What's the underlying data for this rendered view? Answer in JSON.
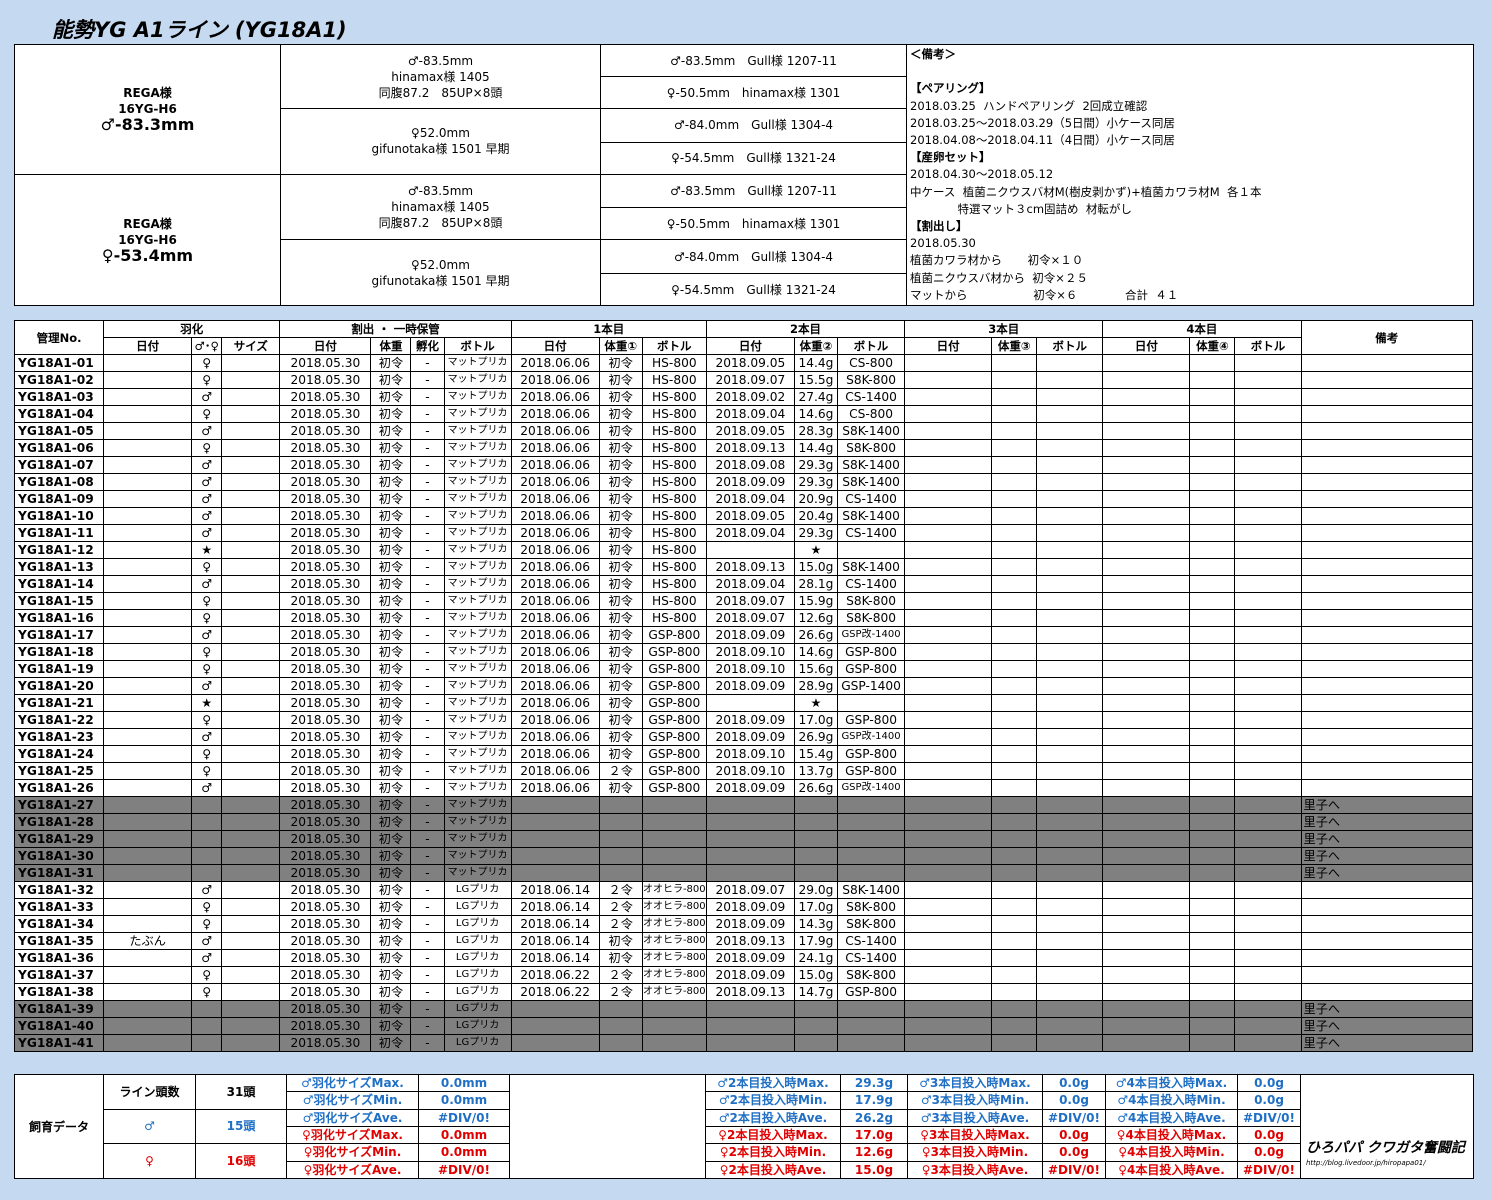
{
  "title": "能勢YG  A1ライン (YG18A1)",
  "pedigree": {
    "parents": [
      {
        "owner": "REGA様",
        "line": "16YG-H6",
        "size": "♂-83.3mm",
        "top_parent": {
          "size": "♂-83.5mm",
          "owner": "hinamax様 1405",
          "note": "同腹87.2　85UP×8頭"
        },
        "bottom_parent": {
          "size": "♀52.0mm",
          "owner": "gifunotaka様 1501 早期"
        },
        "grand": [
          "♂-83.5mm　Gull様 1207-11",
          "♀-50.5mm　hinamax様 1301",
          "♂-84.0mm　Gull様 1304-4",
          "♀-54.5mm　Gull様 1321-24"
        ]
      },
      {
        "owner": "REGA様",
        "line": "16YG-H6",
        "size": "♀-53.4mm",
        "top_parent": {
          "size": "♂-83.5mm",
          "owner": "hinamax様 1405",
          "note": "同腹87.2　85UP×8頭"
        },
        "bottom_parent": {
          "size": "♀52.0mm",
          "owner": "gifunotaka様 1501 早期"
        },
        "grand": [
          "♂-83.5mm　Gull様 1207-11",
          "♀-50.5mm　hinamax様 1301",
          "♂-84.0mm　Gull様 1304-4",
          "♀-54.5mm　Gull様 1321-24"
        ]
      }
    ],
    "notes": [
      {
        "t": "＜備考＞",
        "b": true
      },
      {
        "t": "",
        "b": false
      },
      {
        "t": "【ペアリング】",
        "b": true
      },
      {
        "t": "2018.03.25  ハンドペアリング  2回成立確認",
        "b": false
      },
      {
        "t": "2018.03.25～2018.03.29（5日間）小ケース同居",
        "b": false
      },
      {
        "t": "2018.04.08～2018.04.11（4日間）小ケース同居",
        "b": false
      },
      {
        "t": "【産卵セット】",
        "b": true
      },
      {
        "t": "2018.04.30～2018.05.12",
        "b": false
      },
      {
        "t": "中ケース  植菌ニクウスバ材M(樹皮剥かず)+植菌カワラ材M  各１本",
        "b": false
      },
      {
        "t": "             特選マット３cm固詰め  材転がし",
        "b": false
      },
      {
        "t": "【割出し】",
        "b": true
      },
      {
        "t": "2018.05.30",
        "b": false
      },
      {
        "t": "植菌カワラ材から       初令×１０",
        "b": false
      },
      {
        "t": "植菌ニクウスバ材から  初令×２５",
        "b": false
      },
      {
        "t": "マットから                  初令×６             合計  ４１",
        "b": false
      }
    ]
  },
  "headers": {
    "kanri": "管理No.",
    "uka": "羽化",
    "wari": "割出 ・ 一時保管",
    "b1": "1本目",
    "b2": "2本目",
    "b3": "3本目",
    "b4": "4本目",
    "biko": "備考",
    "date": "日付",
    "sex": "♂･♀",
    "size": "サイズ",
    "weight": "体重",
    "fuka": "孵化",
    "bottle": "ボトル",
    "w1": "体重①",
    "w2": "体重②",
    "w3": "体重③",
    "w4": "体重④"
  },
  "rows": [
    {
      "id": "YG18A1-01",
      "ud": "",
      "sex": "♀",
      "sz": "",
      "wd": "2018.05.30",
      "ww": "初令",
      "wf": "-",
      "wb": "マットプリカ",
      "d1": "2018.06.06",
      "w1": "初令",
      "b1": "HS-800",
      "d2": "2018.09.05",
      "w2": "14.4g",
      "b2": "CS-800",
      "note": "",
      "gray": false
    },
    {
      "id": "YG18A1-02",
      "ud": "",
      "sex": "♀",
      "sz": "",
      "wd": "2018.05.30",
      "ww": "初令",
      "wf": "-",
      "wb": "マットプリカ",
      "d1": "2018.06.06",
      "w1": "初令",
      "b1": "HS-800",
      "d2": "2018.09.07",
      "w2": "15.5g",
      "b2": "S8K-800",
      "note": "",
      "gray": false
    },
    {
      "id": "YG18A1-03",
      "ud": "",
      "sex": "♂",
      "sz": "",
      "wd": "2018.05.30",
      "ww": "初令",
      "wf": "-",
      "wb": "マットプリカ",
      "d1": "2018.06.06",
      "w1": "初令",
      "b1": "HS-800",
      "d2": "2018.09.02",
      "w2": "27.4g",
      "b2": "CS-1400",
      "note": "",
      "gray": false
    },
    {
      "id": "YG18A1-04",
      "ud": "",
      "sex": "♀",
      "sz": "",
      "wd": "2018.05.30",
      "ww": "初令",
      "wf": "-",
      "wb": "マットプリカ",
      "d1": "2018.06.06",
      "w1": "初令",
      "b1": "HS-800",
      "d2": "2018.09.04",
      "w2": "14.6g",
      "b2": "CS-800",
      "note": "",
      "gray": false
    },
    {
      "id": "YG18A1-05",
      "ud": "",
      "sex": "♂",
      "sz": "",
      "wd": "2018.05.30",
      "ww": "初令",
      "wf": "-",
      "wb": "マットプリカ",
      "d1": "2018.06.06",
      "w1": "初令",
      "b1": "HS-800",
      "d2": "2018.09.05",
      "w2": "28.3g",
      "b2": "S8K-1400",
      "note": "",
      "gray": false
    },
    {
      "id": "YG18A1-06",
      "ud": "",
      "sex": "♀",
      "sz": "",
      "wd": "2018.05.30",
      "ww": "初令",
      "wf": "-",
      "wb": "マットプリカ",
      "d1": "2018.06.06",
      "w1": "初令",
      "b1": "HS-800",
      "d2": "2018.09.13",
      "w2": "14.4g",
      "b2": "S8K-800",
      "note": "",
      "gray": false
    },
    {
      "id": "YG18A1-07",
      "ud": "",
      "sex": "♂",
      "sz": "",
      "wd": "2018.05.30",
      "ww": "初令",
      "wf": "-",
      "wb": "マットプリカ",
      "d1": "2018.06.06",
      "w1": "初令",
      "b1": "HS-800",
      "d2": "2018.09.08",
      "w2": "29.3g",
      "b2": "S8K-1400",
      "note": "",
      "gray": false
    },
    {
      "id": "YG18A1-08",
      "ud": "",
      "sex": "♂",
      "sz": "",
      "wd": "2018.05.30",
      "ww": "初令",
      "wf": "-",
      "wb": "マットプリカ",
      "d1": "2018.06.06",
      "w1": "初令",
      "b1": "HS-800",
      "d2": "2018.09.09",
      "w2": "29.3g",
      "b2": "S8K-1400",
      "note": "",
      "gray": false
    },
    {
      "id": "YG18A1-09",
      "ud": "",
      "sex": "♂",
      "sz": "",
      "wd": "2018.05.30",
      "ww": "初令",
      "wf": "-",
      "wb": "マットプリカ",
      "d1": "2018.06.06",
      "w1": "初令",
      "b1": "HS-800",
      "d2": "2018.09.04",
      "w2": "20.9g",
      "b2": "CS-1400",
      "note": "",
      "gray": false
    },
    {
      "id": "YG18A1-10",
      "ud": "",
      "sex": "♂",
      "sz": "",
      "wd": "2018.05.30",
      "ww": "初令",
      "wf": "-",
      "wb": "マットプリカ",
      "d1": "2018.06.06",
      "w1": "初令",
      "b1": "HS-800",
      "d2": "2018.09.05",
      "w2": "20.4g",
      "b2": "S8K-1400",
      "note": "",
      "gray": false
    },
    {
      "id": "YG18A1-11",
      "ud": "",
      "sex": "♂",
      "sz": "",
      "wd": "2018.05.30",
      "ww": "初令",
      "wf": "-",
      "wb": "マットプリカ",
      "d1": "2018.06.06",
      "w1": "初令",
      "b1": "HS-800",
      "d2": "2018.09.04",
      "w2": "29.3g",
      "b2": "CS-1400",
      "note": "",
      "gray": false
    },
    {
      "id": "YG18A1-12",
      "ud": "",
      "sex": "★",
      "sz": "",
      "wd": "2018.05.30",
      "ww": "初令",
      "wf": "-",
      "wb": "マットプリカ",
      "d1": "2018.06.06",
      "w1": "初令",
      "b1": "HS-800",
      "d2": "",
      "w2": "★",
      "b2": "",
      "note": "",
      "gray": false
    },
    {
      "id": "YG18A1-13",
      "ud": "",
      "sex": "♀",
      "sz": "",
      "wd": "2018.05.30",
      "ww": "初令",
      "wf": "-",
      "wb": "マットプリカ",
      "d1": "2018.06.06",
      "w1": "初令",
      "b1": "HS-800",
      "d2": "2018.09.13",
      "w2": "15.0g",
      "b2": "S8K-1400",
      "note": "",
      "gray": false
    },
    {
      "id": "YG18A1-14",
      "ud": "",
      "sex": "♂",
      "sz": "",
      "wd": "2018.05.30",
      "ww": "初令",
      "wf": "-",
      "wb": "マットプリカ",
      "d1": "2018.06.06",
      "w1": "初令",
      "b1": "HS-800",
      "d2": "2018.09.04",
      "w2": "28.1g",
      "b2": "CS-1400",
      "note": "",
      "gray": false
    },
    {
      "id": "YG18A1-15",
      "ud": "",
      "sex": "♀",
      "sz": "",
      "wd": "2018.05.30",
      "ww": "初令",
      "wf": "-",
      "wb": "マットプリカ",
      "d1": "2018.06.06",
      "w1": "初令",
      "b1": "HS-800",
      "d2": "2018.09.07",
      "w2": "15.9g",
      "b2": "S8K-800",
      "note": "",
      "gray": false
    },
    {
      "id": "YG18A1-16",
      "ud": "",
      "sex": "♀",
      "sz": "",
      "wd": "2018.05.30",
      "ww": "初令",
      "wf": "-",
      "wb": "マットプリカ",
      "d1": "2018.06.06",
      "w1": "初令",
      "b1": "HS-800",
      "d2": "2018.09.07",
      "w2": "12.6g",
      "b2": "S8K-800",
      "note": "",
      "gray": false
    },
    {
      "id": "YG18A1-17",
      "ud": "",
      "sex": "♂",
      "sz": "",
      "wd": "2018.05.30",
      "ww": "初令",
      "wf": "-",
      "wb": "マットプリカ",
      "d1": "2018.06.06",
      "w1": "初令",
      "b1": "GSP-800",
      "d2": "2018.09.09",
      "w2": "26.6g",
      "b2": "GSP改-1400",
      "note": "",
      "gray": false
    },
    {
      "id": "YG18A1-18",
      "ud": "",
      "sex": "♀",
      "sz": "",
      "wd": "2018.05.30",
      "ww": "初令",
      "wf": "-",
      "wb": "マットプリカ",
      "d1": "2018.06.06",
      "w1": "初令",
      "b1": "GSP-800",
      "d2": "2018.09.10",
      "w2": "14.6g",
      "b2": "GSP-800",
      "note": "",
      "gray": false
    },
    {
      "id": "YG18A1-19",
      "ud": "",
      "sex": "♀",
      "sz": "",
      "wd": "2018.05.30",
      "ww": "初令",
      "wf": "-",
      "wb": "マットプリカ",
      "d1": "2018.06.06",
      "w1": "初令",
      "b1": "GSP-800",
      "d2": "2018.09.10",
      "w2": "15.6g",
      "b2": "GSP-800",
      "note": "",
      "gray": false
    },
    {
      "id": "YG18A1-20",
      "ud": "",
      "sex": "♂",
      "sz": "",
      "wd": "2018.05.30",
      "ww": "初令",
      "wf": "-",
      "wb": "マットプリカ",
      "d1": "2018.06.06",
      "w1": "初令",
      "b1": "GSP-800",
      "d2": "2018.09.09",
      "w2": "28.9g",
      "b2": "GSP-1400",
      "note": "",
      "gray": false
    },
    {
      "id": "YG18A1-21",
      "ud": "",
      "sex": "★",
      "sz": "",
      "wd": "2018.05.30",
      "ww": "初令",
      "wf": "-",
      "wb": "マットプリカ",
      "d1": "2018.06.06",
      "w1": "初令",
      "b1": "GSP-800",
      "d2": "",
      "w2": "★",
      "b2": "",
      "note": "",
      "gray": false
    },
    {
      "id": "YG18A1-22",
      "ud": "",
      "sex": "♀",
      "sz": "",
      "wd": "2018.05.30",
      "ww": "初令",
      "wf": "-",
      "wb": "マットプリカ",
      "d1": "2018.06.06",
      "w1": "初令",
      "b1": "GSP-800",
      "d2": "2018.09.09",
      "w2": "17.0g",
      "b2": "GSP-800",
      "note": "",
      "gray": false
    },
    {
      "id": "YG18A1-23",
      "ud": "",
      "sex": "♂",
      "sz": "",
      "wd": "2018.05.30",
      "ww": "初令",
      "wf": "-",
      "wb": "マットプリカ",
      "d1": "2018.06.06",
      "w1": "初令",
      "b1": "GSP-800",
      "d2": "2018.09.09",
      "w2": "26.9g",
      "b2": "GSP改-1400",
      "note": "",
      "gray": false
    },
    {
      "id": "YG18A1-24",
      "ud": "",
      "sex": "♀",
      "sz": "",
      "wd": "2018.05.30",
      "ww": "初令",
      "wf": "-",
      "wb": "マットプリカ",
      "d1": "2018.06.06",
      "w1": "初令",
      "b1": "GSP-800",
      "d2": "2018.09.10",
      "w2": "15.4g",
      "b2": "GSP-800",
      "note": "",
      "gray": false
    },
    {
      "id": "YG18A1-25",
      "ud": "",
      "sex": "♀",
      "sz": "",
      "wd": "2018.05.30",
      "ww": "初令",
      "wf": "-",
      "wb": "マットプリカ",
      "d1": "2018.06.06",
      "w1": "２令",
      "b1": "GSP-800",
      "d2": "2018.09.10",
      "w2": "13.7g",
      "b2": "GSP-800",
      "note": "",
      "gray": false
    },
    {
      "id": "YG18A1-26",
      "ud": "",
      "sex": "♂",
      "sz": "",
      "wd": "2018.05.30",
      "ww": "初令",
      "wf": "-",
      "wb": "マットプリカ",
      "d1": "2018.06.06",
      "w1": "初令",
      "b1": "GSP-800",
      "d2": "2018.09.09",
      "w2": "26.6g",
      "b2": "GSP改-1400",
      "note": "",
      "gray": false
    },
    {
      "id": "YG18A1-27",
      "ud": "",
      "sex": "",
      "sz": "",
      "wd": "2018.05.30",
      "ww": "初令",
      "wf": "-",
      "wb": "マットプリカ",
      "d1": "",
      "w1": "",
      "b1": "",
      "d2": "",
      "w2": "",
      "b2": "",
      "note": "里子へ",
      "gray": true
    },
    {
      "id": "YG18A1-28",
      "ud": "",
      "sex": "",
      "sz": "",
      "wd": "2018.05.30",
      "ww": "初令",
      "wf": "-",
      "wb": "マットプリカ",
      "d1": "",
      "w1": "",
      "b1": "",
      "d2": "",
      "w2": "",
      "b2": "",
      "note": "里子へ",
      "gray": true
    },
    {
      "id": "YG18A1-29",
      "ud": "",
      "sex": "",
      "sz": "",
      "wd": "2018.05.30",
      "ww": "初令",
      "wf": "-",
      "wb": "マットプリカ",
      "d1": "",
      "w1": "",
      "b1": "",
      "d2": "",
      "w2": "",
      "b2": "",
      "note": "里子へ",
      "gray": true
    },
    {
      "id": "YG18A1-30",
      "ud": "",
      "sex": "",
      "sz": "",
      "wd": "2018.05.30",
      "ww": "初令",
      "wf": "-",
      "wb": "マットプリカ",
      "d1": "",
      "w1": "",
      "b1": "",
      "d2": "",
      "w2": "",
      "b2": "",
      "note": "里子へ",
      "gray": true
    },
    {
      "id": "YG18A1-31",
      "ud": "",
      "sex": "",
      "sz": "",
      "wd": "2018.05.30",
      "ww": "初令",
      "wf": "-",
      "wb": "マットプリカ",
      "d1": "",
      "w1": "",
      "b1": "",
      "d2": "",
      "w2": "",
      "b2": "",
      "note": "里子へ",
      "gray": true
    },
    {
      "id": "YG18A1-32",
      "ud": "",
      "sex": "♂",
      "sz": "",
      "wd": "2018.05.30",
      "ww": "初令",
      "wf": "-",
      "wb": "LGプリカ",
      "d1": "2018.06.14",
      "w1": "２令",
      "b1": "オオヒラ-800",
      "d2": "2018.09.07",
      "w2": "29.0g",
      "b2": "S8K-1400",
      "note": "",
      "gray": false
    },
    {
      "id": "YG18A1-33",
      "ud": "",
      "sex": "♀",
      "sz": "",
      "wd": "2018.05.30",
      "ww": "初令",
      "wf": "-",
      "wb": "LGプリカ",
      "d1": "2018.06.14",
      "w1": "２令",
      "b1": "オオヒラ-800",
      "d2": "2018.09.09",
      "w2": "17.0g",
      "b2": "S8K-800",
      "note": "",
      "gray": false
    },
    {
      "id": "YG18A1-34",
      "ud": "",
      "sex": "♀",
      "sz": "",
      "wd": "2018.05.30",
      "ww": "初令",
      "wf": "-",
      "wb": "LGプリカ",
      "d1": "2018.06.14",
      "w1": "２令",
      "b1": "オオヒラ-800",
      "d2": "2018.09.09",
      "w2": "14.3g",
      "b2": "S8K-800",
      "note": "",
      "gray": false
    },
    {
      "id": "YG18A1-35",
      "ud": "たぶん",
      "sex": "♂",
      "sz": "",
      "wd": "2018.05.30",
      "ww": "初令",
      "wf": "-",
      "wb": "LGプリカ",
      "d1": "2018.06.14",
      "w1": "初令",
      "b1": "オオヒラ-800",
      "d2": "2018.09.13",
      "w2": "17.9g",
      "b2": "CS-1400",
      "note": "",
      "gray": false
    },
    {
      "id": "YG18A1-36",
      "ud": "",
      "sex": "♂",
      "sz": "",
      "wd": "2018.05.30",
      "ww": "初令",
      "wf": "-",
      "wb": "LGプリカ",
      "d1": "2018.06.14",
      "w1": "初令",
      "b1": "オオヒラ-800",
      "d2": "2018.09.09",
      "w2": "24.1g",
      "b2": "CS-1400",
      "note": "",
      "gray": false
    },
    {
      "id": "YG18A1-37",
      "ud": "",
      "sex": "♀",
      "sz": "",
      "wd": "2018.05.30",
      "ww": "初令",
      "wf": "-",
      "wb": "LGプリカ",
      "d1": "2018.06.22",
      "w1": "２令",
      "b1": "オオヒラ-800",
      "d2": "2018.09.09",
      "w2": "15.0g",
      "b2": "S8K-800",
      "note": "",
      "gray": false
    },
    {
      "id": "YG18A1-38",
      "ud": "",
      "sex": "♀",
      "sz": "",
      "wd": "2018.05.30",
      "ww": "初令",
      "wf": "-",
      "wb": "LGプリカ",
      "d1": "2018.06.22",
      "w1": "２令",
      "b1": "オオヒラ-800",
      "d2": "2018.09.13",
      "w2": "14.7g",
      "b2": "GSP-800",
      "note": "",
      "gray": false
    },
    {
      "id": "YG18A1-39",
      "ud": "",
      "sex": "",
      "sz": "",
      "wd": "2018.05.30",
      "ww": "初令",
      "wf": "-",
      "wb": "LGプリカ",
      "d1": "",
      "w1": "",
      "b1": "",
      "d2": "",
      "w2": "",
      "b2": "",
      "note": "里子へ",
      "gray": true
    },
    {
      "id": "YG18A1-40",
      "ud": "",
      "sex": "",
      "sz": "",
      "wd": "2018.05.30",
      "ww": "初令",
      "wf": "-",
      "wb": "LGプリカ",
      "d1": "",
      "w1": "",
      "b1": "",
      "d2": "",
      "w2": "",
      "b2": "",
      "note": "里子へ",
      "gray": true
    },
    {
      "id": "YG18A1-41",
      "ud": "",
      "sex": "",
      "sz": "",
      "wd": "2018.05.30",
      "ww": "初令",
      "wf": "-",
      "wb": "LGプリカ",
      "d1": "",
      "w1": "",
      "b1": "",
      "d2": "",
      "w2": "",
      "b2": "",
      "note": "里子へ",
      "gray": true
    }
  ],
  "summary": {
    "label": "飼育データ",
    "count_label": "ライン頭数",
    "count": "31頭",
    "male_sym": "♂",
    "male_count": "15頭",
    "female_sym": "♀",
    "female_count": "16頭",
    "uka": [
      {
        "k": "♂羽化サイズMax.",
        "v": "0.0mm",
        "c": "blue"
      },
      {
        "k": "♂羽化サイズMin.",
        "v": "0.0mm",
        "c": "blue"
      },
      {
        "k": "♂羽化サイズAve.",
        "v": "#DIV/0!",
        "c": "blue"
      },
      {
        "k": "♀羽化サイズMax.",
        "v": "0.0mm",
        "c": "red"
      },
      {
        "k": "♀羽化サイズMin.",
        "v": "0.0mm",
        "c": "red"
      },
      {
        "k": "♀羽化サイズAve.",
        "v": "#DIV/0!",
        "c": "red"
      }
    ],
    "b2": [
      {
        "k": "♂2本目投入時Max.",
        "v": "29.3g",
        "c": "blue"
      },
      {
        "k": "♂2本目投入時Min.",
        "v": "17.9g",
        "c": "blue"
      },
      {
        "k": "♂2本目投入時Ave.",
        "v": "26.2g",
        "c": "blue"
      },
      {
        "k": "♀2本目投入時Max.",
        "v": "17.0g",
        "c": "red"
      },
      {
        "k": "♀2本目投入時Min.",
        "v": "12.6g",
        "c": "red"
      },
      {
        "k": "♀2本目投入時Ave.",
        "v": "15.0g",
        "c": "red"
      }
    ],
    "b3": [
      {
        "k": "♂3本目投入時Max.",
        "v": "0.0g",
        "c": "blue"
      },
      {
        "k": "♂3本目投入時Min.",
        "v": "0.0g",
        "c": "blue"
      },
      {
        "k": "♂3本目投入時Ave.",
        "v": "#DIV/0!",
        "c": "blue"
      },
      {
        "k": "♀3本目投入時Max.",
        "v": "0.0g",
        "c": "red"
      },
      {
        "k": "♀3本目投入時Min.",
        "v": "0.0g",
        "c": "red"
      },
      {
        "k": "♀3本目投入時Ave.",
        "v": "#DIV/0!",
        "c": "red"
      }
    ],
    "b4": [
      {
        "k": "♂4本目投入時Max.",
        "v": "0.0g",
        "c": "blue"
      },
      {
        "k": "♂4本目投入時Min.",
        "v": "0.0g",
        "c": "blue"
      },
      {
        "k": "♂4本目投入時Ave.",
        "v": "#DIV/0!",
        "c": "blue"
      },
      {
        "k": "♀4本目投入時Max.",
        "v": "0.0g",
        "c": "red"
      },
      {
        "k": "♀4本目投入時Min.",
        "v": "0.0g",
        "c": "red"
      },
      {
        "k": "♀4本目投入時Ave.",
        "v": "#DIV/0!",
        "c": "red"
      }
    ],
    "logo_main": "ひろパパ  クワガタ奮闘記",
    "logo_sub": "http://blog.livedoor.jp/hiropapa01/"
  }
}
